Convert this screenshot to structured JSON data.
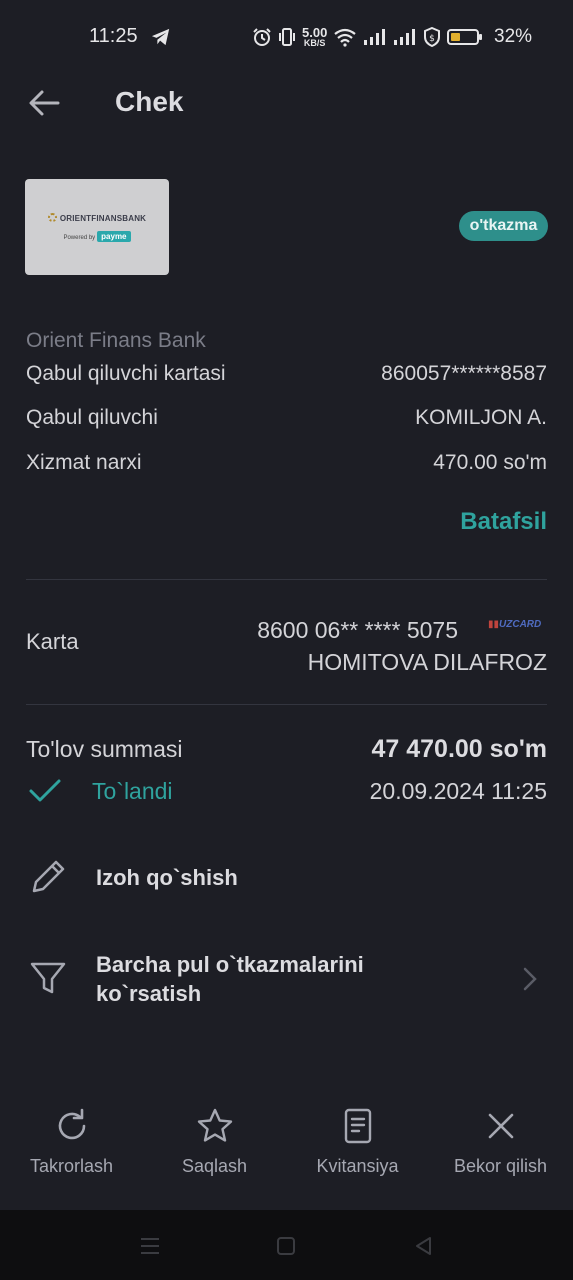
{
  "status_bar": {
    "time": "11:25",
    "net_speed_value": "5.00",
    "net_speed_unit": "KB/S",
    "battery_percent": "32%",
    "icons": [
      "telegram-icon",
      "alarm-icon",
      "vibrate-icon",
      "wifi-icon",
      "signal-icon",
      "signal-icon",
      "shield-icon",
      "battery-icon"
    ]
  },
  "header": {
    "title": "Chek",
    "back_icon": "arrow-left-icon"
  },
  "merchant": {
    "logo_text": "ORIENTFINANSBANK",
    "logo_powered": "Powered by",
    "logo_brand": "payme",
    "type_badge": "o'tkazma",
    "bank_name": "Orient Finans Bank"
  },
  "details": {
    "rows": [
      {
        "label": "Qabul qiluvchi kartasi",
        "value": "860057******8587"
      },
      {
        "label": "Qabul qiluvchi",
        "value": "KOMILJON A."
      },
      {
        "label": "Xizmat narxi",
        "value": "470.00 so'm"
      }
    ],
    "more_link": "Batafsil"
  },
  "card": {
    "label": "Karta",
    "number": "8600 06** **** 5075",
    "brand": "UZCARD",
    "holder": "HOMITOVA DILAFROZ"
  },
  "payment": {
    "label": "To'lov summasi",
    "amount": "47 470.00 so'm",
    "status": "To`landi",
    "datetime": "20.09.2024 11:25"
  },
  "actions": [
    {
      "label": "Izoh qo`shish",
      "icon": "pencil-icon"
    },
    {
      "label": "Barcha pul o`tkazmalarini ko`rsatish",
      "icon": "filter-icon"
    }
  ],
  "bottom_bar": [
    {
      "label": "Takrorlash",
      "icon": "repeat-icon"
    },
    {
      "label": "Saqlash",
      "icon": "star-icon"
    },
    {
      "label": "Kvitansiya",
      "icon": "receipt-icon"
    },
    {
      "label": "Bekor qilish",
      "icon": "close-icon"
    }
  ],
  "colors": {
    "background": "#1d1e25",
    "accent": "#2fa39e",
    "badge": "#2e8f8b",
    "muted_text": "#7b7d88"
  }
}
